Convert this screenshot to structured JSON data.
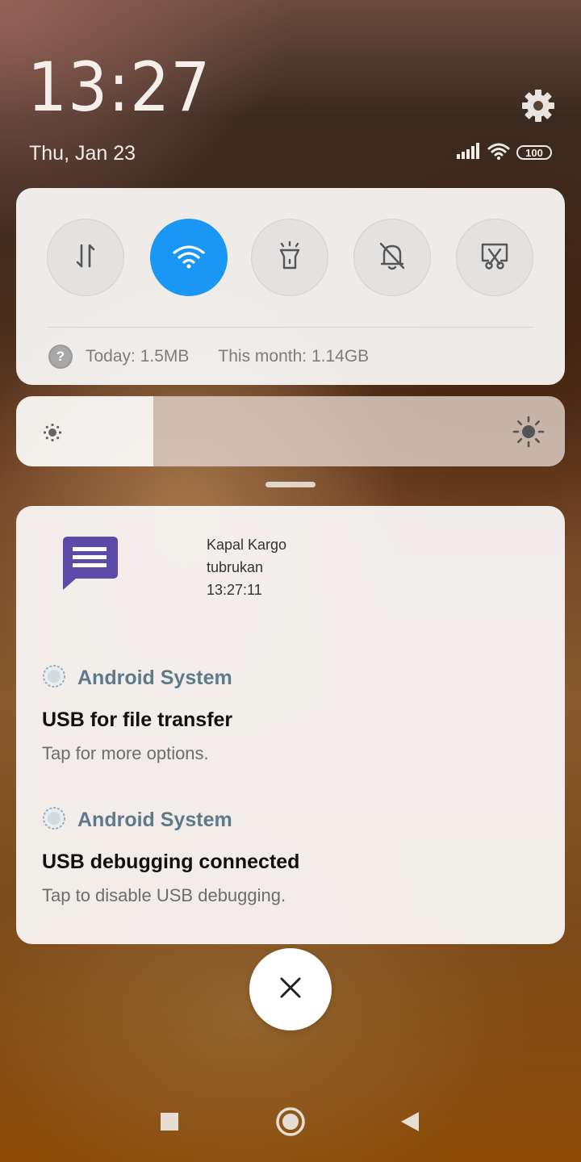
{
  "header": {
    "time": "13:27",
    "date": "Thu, Jan 23",
    "battery": "100"
  },
  "quick_settings": {
    "toggles": [
      {
        "name": "mobile-data",
        "on": false
      },
      {
        "name": "wifi",
        "on": true
      },
      {
        "name": "flashlight",
        "on": false
      },
      {
        "name": "silent",
        "on": false
      },
      {
        "name": "screenshot",
        "on": false
      }
    ],
    "usage_today": "Today: 1.5MB",
    "usage_month": "This month: 1.14GB"
  },
  "brightness": {
    "level": 0.25
  },
  "notifications": {
    "message": {
      "line1": "Kapal Kargo",
      "line2": "tubrukan",
      "line3": "13:27:11"
    },
    "items": [
      {
        "app": "Android System",
        "title": "USB for file transfer",
        "body": "Tap for more options."
      },
      {
        "app": "Android System",
        "title": "USB debugging connected",
        "body": "Tap to disable USB debugging."
      }
    ]
  },
  "colors": {
    "accent": "#1a96f5",
    "app_name": "#5e7a8a",
    "message_icon": "#5b4aa8"
  }
}
